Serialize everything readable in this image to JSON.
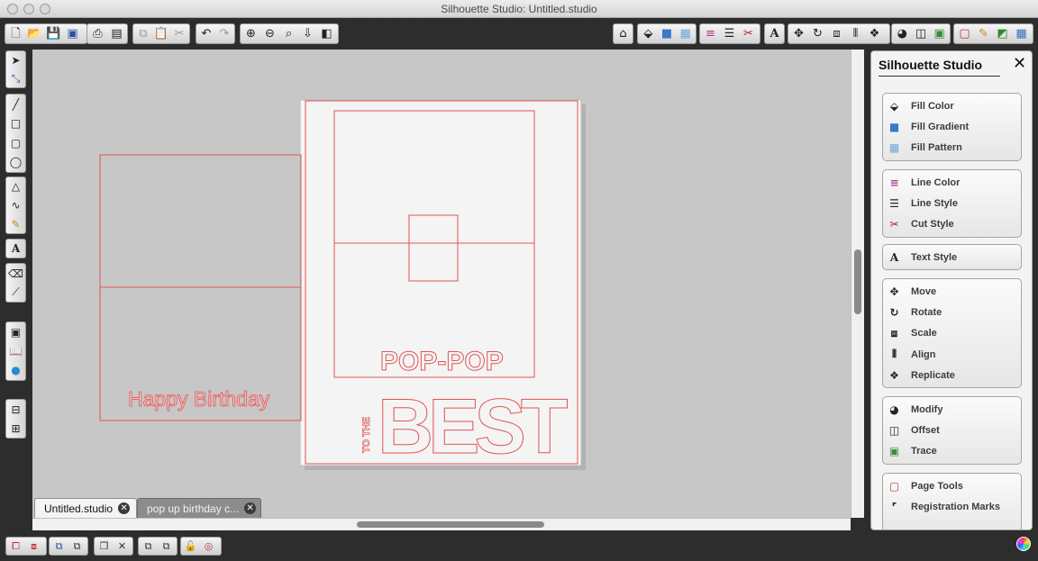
{
  "window": {
    "title": "Silhouette Studio: Untitled.studio"
  },
  "tabs": [
    {
      "label": "Untitled.studio",
      "close": "✕"
    },
    {
      "label": "pop up birthday c...",
      "close": "✕"
    }
  ],
  "canvas": {
    "texts": {
      "happy_birthday": "Happy Birthday",
      "pop_pop": "POP-POP",
      "to_the": "TO THE",
      "best": "BEST"
    }
  },
  "panel": {
    "title": "Silhouette Studio",
    "close": "✕",
    "groups": [
      {
        "items": [
          {
            "label": "Fill Color",
            "icon": "fill-color-icon"
          },
          {
            "label": "Fill Gradient",
            "icon": "fill-gradient-icon"
          },
          {
            "label": "Fill Pattern",
            "icon": "fill-pattern-icon"
          }
        ]
      },
      {
        "items": [
          {
            "label": "Line Color",
            "icon": "line-color-icon"
          },
          {
            "label": "Line Style",
            "icon": "line-style-icon"
          },
          {
            "label": "Cut Style",
            "icon": "cut-style-icon"
          }
        ]
      },
      {
        "items": [
          {
            "label": "Text Style",
            "icon": "text-style-icon"
          }
        ]
      },
      {
        "items": [
          {
            "label": "Move",
            "icon": "move-icon"
          },
          {
            "label": "Rotate",
            "icon": "rotate-icon"
          },
          {
            "label": "Scale",
            "icon": "scale-icon"
          },
          {
            "label": "Align",
            "icon": "align-icon"
          },
          {
            "label": "Replicate",
            "icon": "replicate-icon"
          }
        ]
      },
      {
        "items": [
          {
            "label": "Modify",
            "icon": "modify-icon"
          },
          {
            "label": "Offset",
            "icon": "offset-icon"
          },
          {
            "label": "Trace",
            "icon": "trace-icon"
          }
        ]
      },
      {
        "items": [
          {
            "label": "Page Tools",
            "icon": "page-tools-icon"
          },
          {
            "label": "Registration Marks",
            "icon": "registration-marks-icon"
          }
        ]
      }
    ]
  },
  "colors": {
    "cut_line": "#e05555",
    "canvas_bg": "#c7c7c7",
    "page_bg": "#f4f4f4",
    "chrome": "#2d2d2d"
  }
}
